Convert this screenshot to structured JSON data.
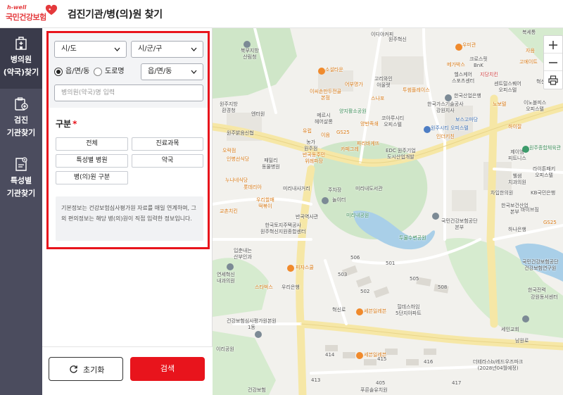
{
  "header": {
    "logo_sub": "h-well",
    "logo_main": "국민건강보험",
    "title": "검진기관/병(의)원 찾기"
  },
  "nav": {
    "items": [
      {
        "label_line1": "병의원",
        "label_line2": "(약국)찾기",
        "icon": "hospital-building-icon",
        "active": true
      },
      {
        "label_line1": "검진",
        "label_line2": "기관찾기",
        "icon": "checkup-clipboard-icon",
        "active": false
      },
      {
        "label_line1": "특성별",
        "label_line2": "기관찾기",
        "icon": "special-document-icon",
        "active": false
      }
    ]
  },
  "search": {
    "sido_value": "시/도",
    "sigungu_value": "시/군/구",
    "radio_options": [
      {
        "label": "읍/면/동",
        "checked": true
      },
      {
        "label": "도로명",
        "checked": false
      }
    ],
    "eup_value": "읍/면/동",
    "name_placeholder": "병의원(약국)명 입력"
  },
  "category": {
    "title": "구분",
    "required_mark": "*",
    "buttons": [
      "전체",
      "진료과목",
      "특성별 병원",
      "약국",
      "병(의)원 구분"
    ]
  },
  "info_text": "기본정보는 건강보험심사평가원 자료를 매일 연계하며, 그 외 편의정보는 해당 병(의)원이 직접 입력한 정보입니다.",
  "actions": {
    "reset_label": "초기화",
    "search_label": "검색"
  },
  "colors": {
    "accent_red": "#e8141c",
    "nav_bg": "#4b4c5e",
    "nav_active": "#3a3b4b"
  },
  "map": {
    "labels": [
      {
        "text": "북부지방\n산림청",
        "color": "gray"
      },
      {
        "text": "이디야커피",
        "color": "gray"
      },
      {
        "text": "소설타운",
        "color": "orange"
      },
      {
        "text": "고리와인\n아울렛",
        "color": "gray"
      },
      {
        "text": "우미관",
        "color": "orange"
      },
      {
        "text": "크로스핏\nBnK",
        "color": "gray"
      },
      {
        "text": "복세통",
        "color": "gray"
      },
      {
        "text": "자음",
        "color": "orange"
      },
      {
        "text": "고에이트",
        "color": "orange"
      },
      {
        "text": "메가박스",
        "color": "orange"
      },
      {
        "text": "지당치킨",
        "color": "red"
      },
      {
        "text": "헬스케어\n스포츠센터",
        "color": "gray"
      },
      {
        "text": "이씨손만두전골\n본점",
        "color": "orange"
      },
      {
        "text": "어부명가",
        "color": "orange"
      },
      {
        "text": "스나포",
        "color": "orange"
      },
      {
        "text": "투썸플레이스",
        "color": "orange"
      },
      {
        "text": "한국산업은행",
        "color": "gray"
      },
      {
        "text": "센트럴스퀘어\n오피스텔",
        "color": "gray"
      },
      {
        "text": "혁신로",
        "color": "gray"
      },
      {
        "text": "원주지방\n환경청",
        "color": "gray"
      },
      {
        "text": "메르시\n헤어살롱",
        "color": "gray"
      },
      {
        "text": "양지활소공원",
        "color": "green"
      },
      {
        "text": "엔터원",
        "color": "gray"
      },
      {
        "text": "한국가스기술공사\n강원지사",
        "color": "gray"
      },
      {
        "text": "노보텔",
        "color": "orange"
      },
      {
        "text": "이노블피스\n오피스텔",
        "color": "gray"
      },
      {
        "text": "원주밝음신협",
        "color": "gray"
      },
      {
        "text": "유럽",
        "color": "orange"
      },
      {
        "text": "GS25",
        "color": "orange"
      },
      {
        "text": "양반족쇄",
        "color": "orange"
      },
      {
        "text": "코아루시티\n오피스텔",
        "color": "gray"
      },
      {
        "text": "원주시티 오피스텔",
        "color": "blue"
      },
      {
        "text": "보스고마당",
        "color": "blue"
      },
      {
        "text": "농가\n원주점",
        "color": "gray"
      },
      {
        "text": "이음",
        "color": "orange"
      },
      {
        "text": "파리바게뜨",
        "color": "orange"
      },
      {
        "text": "하이잘",
        "color": "orange"
      },
      {
        "text": "원주종합체육관",
        "color": "green"
      },
      {
        "text": "오락점",
        "color": "orange"
      },
      {
        "text": "반곡동주민\n위례파장",
        "color": "orange"
      },
      {
        "text": "카페그레",
        "color": "orange"
      },
      {
        "text": "EDC 원주기업\n도시산업개발",
        "color": "gray"
      },
      {
        "text": "인더키친",
        "color": "orange"
      },
      {
        "text": "제이엠\n피트니스",
        "color": "gray"
      },
      {
        "text": "인병선식당",
        "color": "orange"
      },
      {
        "text": "패밀리\n동물병원",
        "color": "gray"
      },
      {
        "text": "라이튼패키\n오피스텔",
        "color": "gray"
      },
      {
        "text": "차입한의원",
        "color": "gray"
      },
      {
        "text": "웰샘\n치과의원",
        "color": "gray"
      },
      {
        "text": "누나네식당",
        "color": "orange"
      },
      {
        "text": "미리내사거리",
        "color": "gray"
      },
      {
        "text": "주차장",
        "color": "gray"
      },
      {
        "text": "미리내도서관",
        "color": "gray"
      },
      {
        "text": "KB국민은행",
        "color": "gray"
      },
      {
        "text": "롯데리아",
        "color": "orange"
      },
      {
        "text": "우리할매\n떡볶이",
        "color": "orange"
      },
      {
        "text": "교촌치킨",
        "color": "orange"
      },
      {
        "text": "놀이터",
        "color": "gray"
      },
      {
        "text": "한국보건산업\n본부",
        "color": "gray"
      },
      {
        "text": "바이브짐",
        "color": "gray"
      },
      {
        "text": "반곡역사관",
        "color": "gray"
      },
      {
        "text": "미리내공원",
        "color": "green"
      },
      {
        "text": "국민건강보험공단\n본부",
        "color": "gray"
      },
      {
        "text": "하나은행",
        "color": "gray"
      },
      {
        "text": "GS25",
        "color": "orange"
      },
      {
        "text": "한국토지주택공사\n원주혁신지원종합센터",
        "color": "gray"
      },
      {
        "text": "두물수변공원",
        "color": "green"
      },
      {
        "text": "입춘내는\n산부인과",
        "color": "gray"
      },
      {
        "text": "국민건강보험공단\n건강보험연구원",
        "color": "gray"
      },
      {
        "text": "피자스쿨",
        "color": "orange"
      },
      {
        "text": "연세혁신\n내과의원",
        "color": "gray"
      },
      {
        "text": "스타벅스",
        "color": "orange"
      },
      {
        "text": "우리은행",
        "color": "gray"
      },
      {
        "text": "한국전력",
        "color": "gray"
      },
      {
        "text": "강원동서센터",
        "color": "gray"
      },
      {
        "text": "힐데스하임\n5단지아파트",
        "color": "gray"
      },
      {
        "text": "세븐일레븐",
        "color": "orange"
      },
      {
        "text": "건강보험심사평가원본원\n1동",
        "color": "gray"
      },
      {
        "text": "세인교회",
        "color": "gray"
      },
      {
        "text": "세븐일레븐",
        "color": "orange"
      },
      {
        "text": "더테라스b/레드우즈파크\n(2028년04월예정)",
        "color": "gray"
      },
      {
        "text": "푸른솔유치원",
        "color": "gray"
      },
      {
        "text": "건강보험",
        "color": "gray"
      },
      {
        "text": "혁신로",
        "color": "gray"
      },
      {
        "text": "남원로",
        "color": "gray"
      },
      {
        "text": "이리공원",
        "color": "gray"
      },
      {
        "text": "원주혁신",
        "color": "gray"
      },
      {
        "text": "506",
        "color": "gray"
      },
      {
        "text": "501",
        "color": "gray"
      },
      {
        "text": "505",
        "color": "gray"
      },
      {
        "text": "508",
        "color": "gray"
      },
      {
        "text": "502",
        "color": "gray"
      },
      {
        "text": "503",
        "color": "gray"
      },
      {
        "text": "414",
        "color": "gray"
      },
      {
        "text": "415",
        "color": "gray"
      },
      {
        "text": "416",
        "color": "gray"
      },
      {
        "text": "417",
        "color": "gray"
      },
      {
        "text": "413",
        "color": "gray"
      },
      {
        "text": "405",
        "color": "gray"
      }
    ]
  }
}
